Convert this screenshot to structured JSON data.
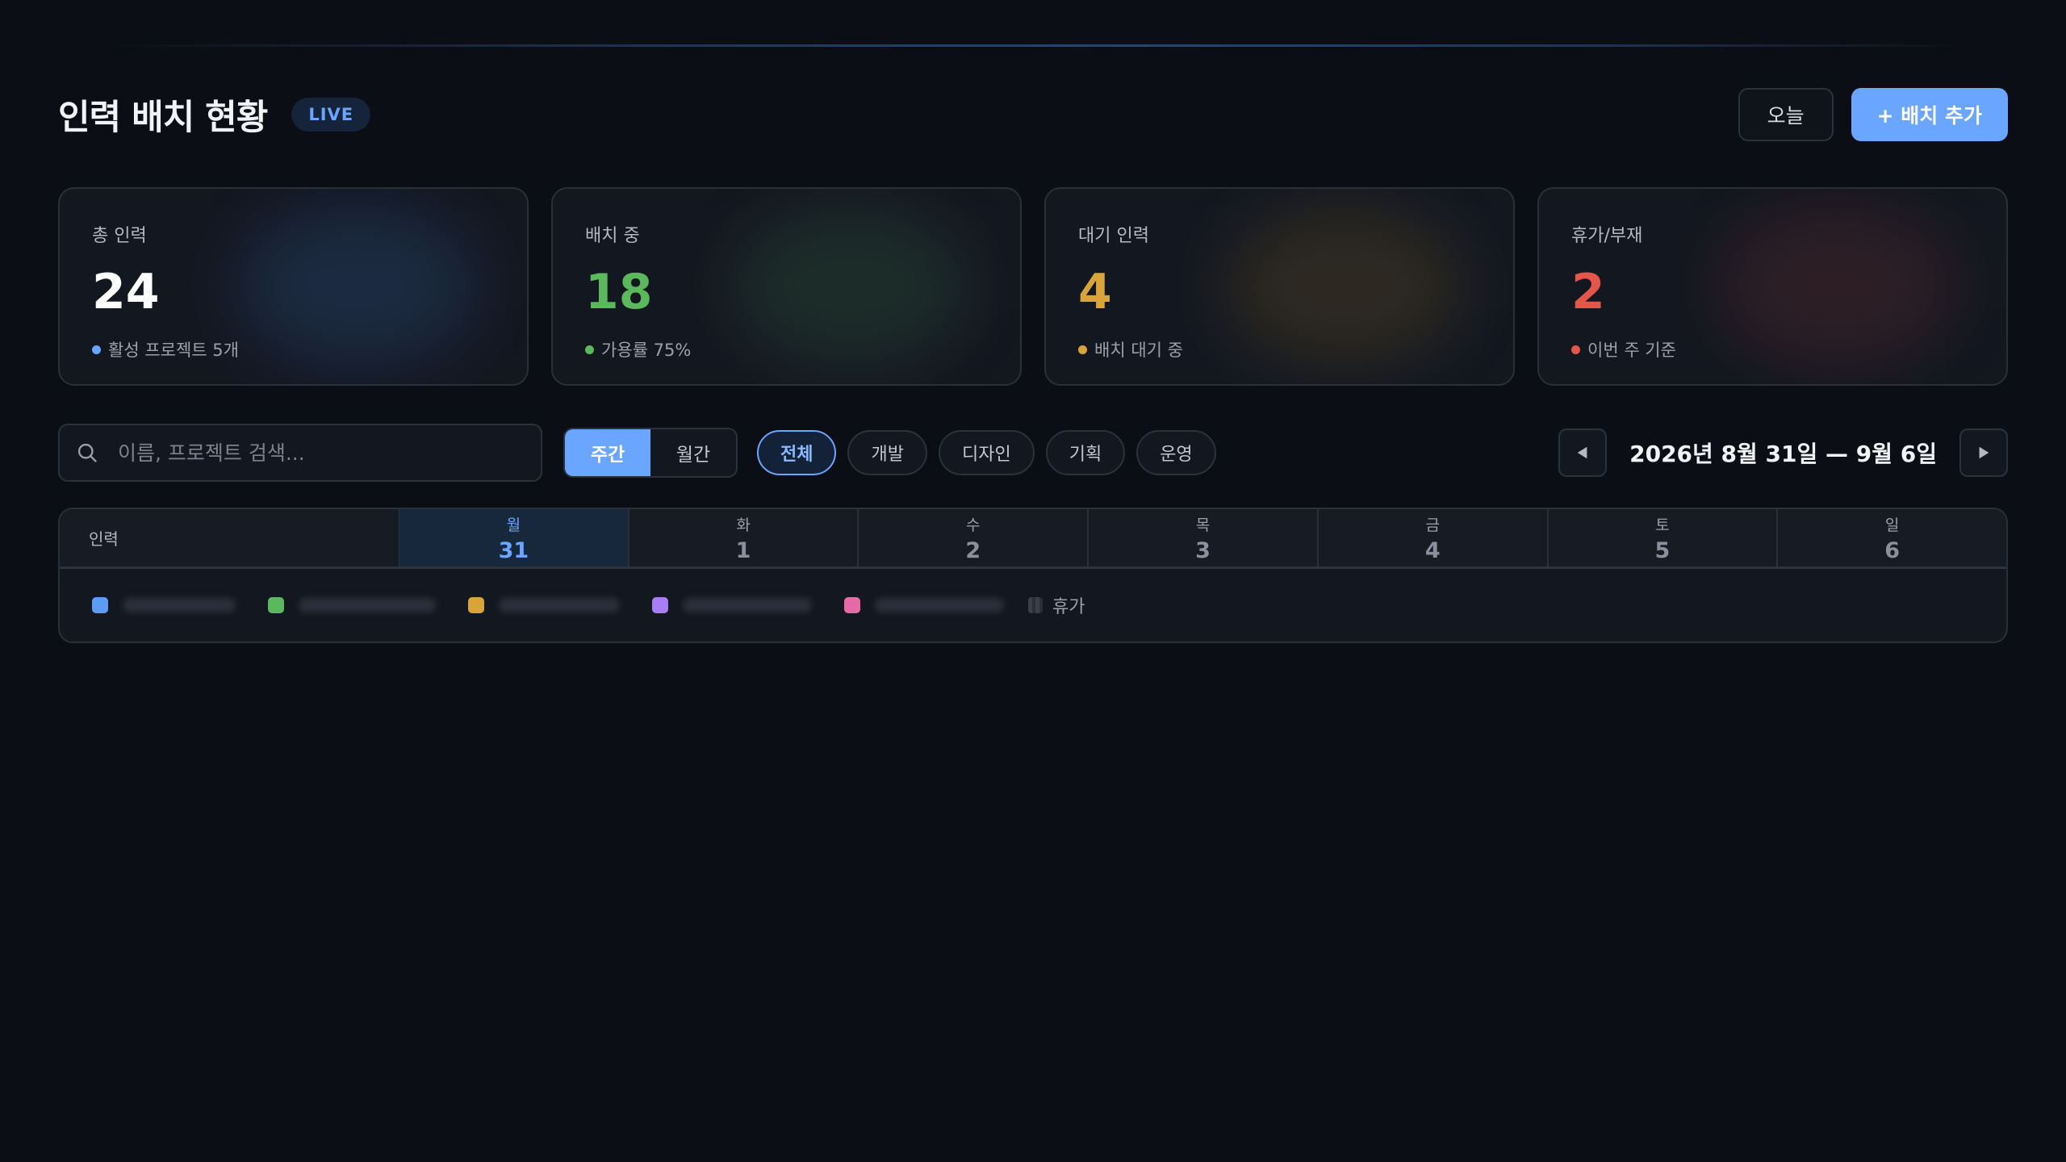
{
  "header": {
    "title": "인력 배치 현황",
    "live_badge": "LIVE",
    "today_button": "오늘",
    "add_button": "+ 배치 추가"
  },
  "stats": [
    {
      "label": "총 인력",
      "value": "24",
      "sub": "활성 프로젝트 5개",
      "color": "#ffffff",
      "dot_color": "#6aa5ff"
    },
    {
      "label": "배치 중",
      "value": "18",
      "sub": "가용률 75%",
      "color": "#5cb85c",
      "dot_color": "#5cb85c"
    },
    {
      "label": "대기 인력",
      "value": "4",
      "sub": "배치 대기 중",
      "color": "#d9a53b",
      "dot_color": "#d9a53b"
    },
    {
      "label": "휴가/부재",
      "value": "2",
      "sub": "이번 주 기준",
      "color": "#e5564a",
      "dot_color": "#e5564a"
    }
  ],
  "toolbar": {
    "search_placeholder": "이름, 프로젝트 검색...",
    "view_modes": [
      "주간",
      "월간"
    ],
    "active_view": "주간",
    "filters": [
      "전체",
      "개발",
      "디자인",
      "기획",
      "운영"
    ],
    "active_filter": "전체",
    "week_range": "2026년 8월 31일 — 9월 6일"
  },
  "grid": {
    "person_header": "인력",
    "days": [
      {
        "name": "월",
        "num": "31",
        "today": true
      },
      {
        "name": "화",
        "num": "1",
        "today": false
      },
      {
        "name": "수",
        "num": "2",
        "today": false
      },
      {
        "name": "목",
        "num": "3",
        "today": false
      },
      {
        "name": "금",
        "num": "4",
        "today": false
      },
      {
        "name": "토",
        "num": "5",
        "today": false
      },
      {
        "name": "일",
        "num": "6",
        "today": false
      }
    ]
  },
  "legend": {
    "colors": [
      "#5b9cf5",
      "#5cb85c",
      "#d9a53b",
      "#a97ef2",
      "#e56aa8"
    ],
    "leave_label": "휴가"
  }
}
